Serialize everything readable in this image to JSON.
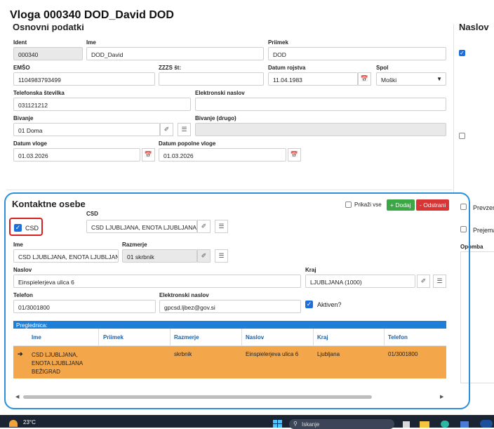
{
  "title": "Vloga 000340 DOD_David DOD",
  "osnovni": {
    "heading": "Osnovni podatki",
    "ident_label": "Ident",
    "ident_value": "000340",
    "ime_label": "Ime",
    "ime_value": "DOD_David",
    "priimek_label": "Priimek",
    "priimek_value": "DOD",
    "emso_label": "EMŠO",
    "emso_value": "1104983793499",
    "zzzs_label": "ZZZS št:",
    "zzzs_value": "",
    "datum_rojstva_label": "Datum rojstva",
    "datum_rojstva_value": "11.04.1983",
    "spol_label": "Spol",
    "spol_value": "Moški",
    "telefon_label": "Telefonska številka",
    "telefon_value": "031121212",
    "email_label": "Elektronski naslov",
    "email_value": "",
    "bivanje_label": "Bivanje",
    "bivanje_value": "01 Doma",
    "bivanje_drugo_label": "Bivanje (drugo)",
    "bivanje_drugo_value": "",
    "datum_vloge_label": "Datum vloge",
    "datum_vloge_value": "01.03.2026",
    "datum_popolne_label": "Datum popolne vloge",
    "datum_popolne_value": "01.03.2026"
  },
  "right_panel": {
    "heading": "Naslov",
    "prevzem": "Prevzem",
    "prejema": "Prejema",
    "opomba": "Opomba"
  },
  "kontaktne": {
    "heading": "Kontaktne osebe",
    "prikazi_vse": "Prikaži vse",
    "dodaj": "+ Dodaj",
    "odstrani": "- Odstrani",
    "csd_checkbox_label": "CSD",
    "csd_label": "CSD",
    "csd_value": "CSD LJUBLJANA, ENOTA LJUBLJANA B",
    "ime_label": "Ime",
    "ime_value": "CSD LJUBLJANA, ENOTA LJUBLJANA",
    "razmerje_label": "Razmerje",
    "razmerje_value": "01 skrbnik",
    "naslov_label": "Naslov",
    "naslov_value": "Einspielerjeva ulica 6",
    "kraj_label": "Kraj",
    "kraj_value": "LJUBLJANA (1000)",
    "telefon_label": "Telefon",
    "telefon_value": "01/3001800",
    "email_label": "Elektronski naslov",
    "email_value": "gpcsd.ljbez@gov.si",
    "aktiven_label": "Aktiven?"
  },
  "grid": {
    "title": "Preglednica:",
    "columns": [
      "Ime",
      "Priimek",
      "Razmerje",
      "Naslov",
      "Kraj",
      "Telefon"
    ],
    "row": {
      "ime": "CSD LJUBLJANA, ENOTA LJUBLJANA BEŽIGRAD",
      "priimek": "",
      "razmerje": "skrbnik",
      "naslov": "Einspielerjeva ulica 6",
      "kraj": "Ljubljana",
      "telefon": "01/3001800"
    }
  },
  "taskbar": {
    "temperature": "23°C",
    "search_placeholder": "Iskanje"
  },
  "colors": {
    "accent": "#1e6fd9",
    "highlight_row": "#f3a64a",
    "outline": "#2b8fdc",
    "add": "#3aa845",
    "remove": "#d93535",
    "csd_box": "#d92020"
  }
}
